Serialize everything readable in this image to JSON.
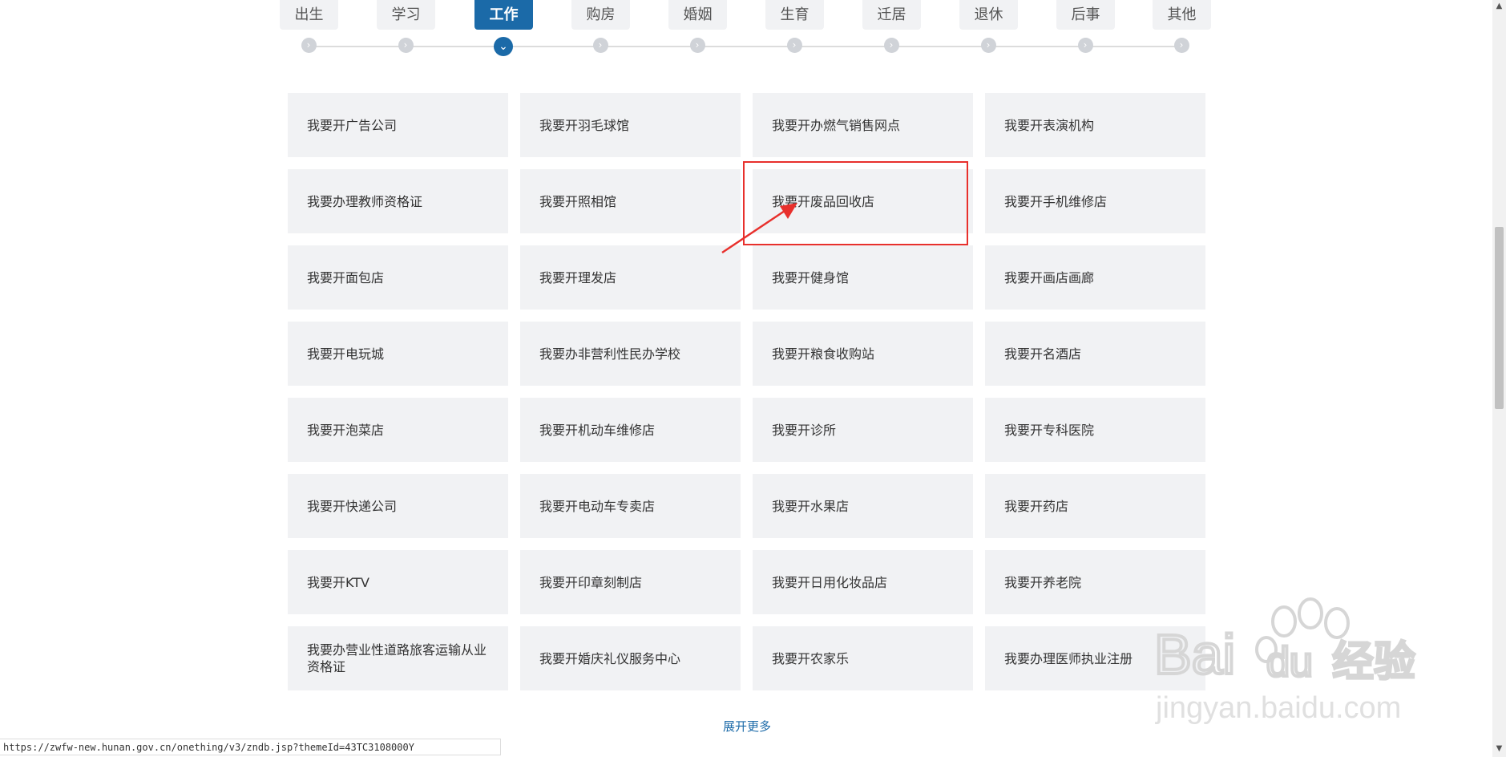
{
  "tabs": [
    {
      "label": "出生"
    },
    {
      "label": "学习"
    },
    {
      "label": "工作",
      "active": true
    },
    {
      "label": "购房"
    },
    {
      "label": "婚姻"
    },
    {
      "label": "生育"
    },
    {
      "label": "迁居"
    },
    {
      "label": "退休"
    },
    {
      "label": "后事"
    },
    {
      "label": "其他"
    }
  ],
  "timeline": {
    "dot_icon": "chevron-right-icon",
    "active_icon": "chevron-down-icon",
    "active_index": 2
  },
  "items": [
    "我要开广告公司",
    "我要开羽毛球馆",
    "我要开办燃气销售网点",
    "我要开表演机构",
    "我要办理教师资格证",
    "我要开照相馆",
    "我要开废品回收店",
    "我要开手机维修店",
    "我要开面包店",
    "我要开理发店",
    "我要开健身馆",
    "我要开画店画廊",
    "我要开电玩城",
    "我要办非营利性民办学校",
    "我要开粮食收购站",
    "我要开名酒店",
    "我要开泡菜店",
    "我要开机动车维修店",
    "我要开诊所",
    "我要开专科医院",
    "我要开快递公司",
    "我要开电动车专卖店",
    "我要开水果店",
    "我要开药店",
    "我要开KTV",
    "我要开印章刻制店",
    "我要开日用化妆品店",
    "我要开养老院",
    "我要办营业性道路旅客运输从业资格证",
    "我要开婚庆礼仪服务中心",
    "我要开农家乐",
    "我要办理医师执业注册"
  ],
  "highlighted_item": "我要开废品回收店",
  "more_label": "展开更多",
  "status_url": "https://zwfw-new.hunan.gov.cn/onething/v3/zndb.jsp?themeId=43TC3108000Y",
  "colors": {
    "accent": "#1b6aa8",
    "highlight": "#e8302c",
    "card_bg": "#f1f2f4"
  }
}
